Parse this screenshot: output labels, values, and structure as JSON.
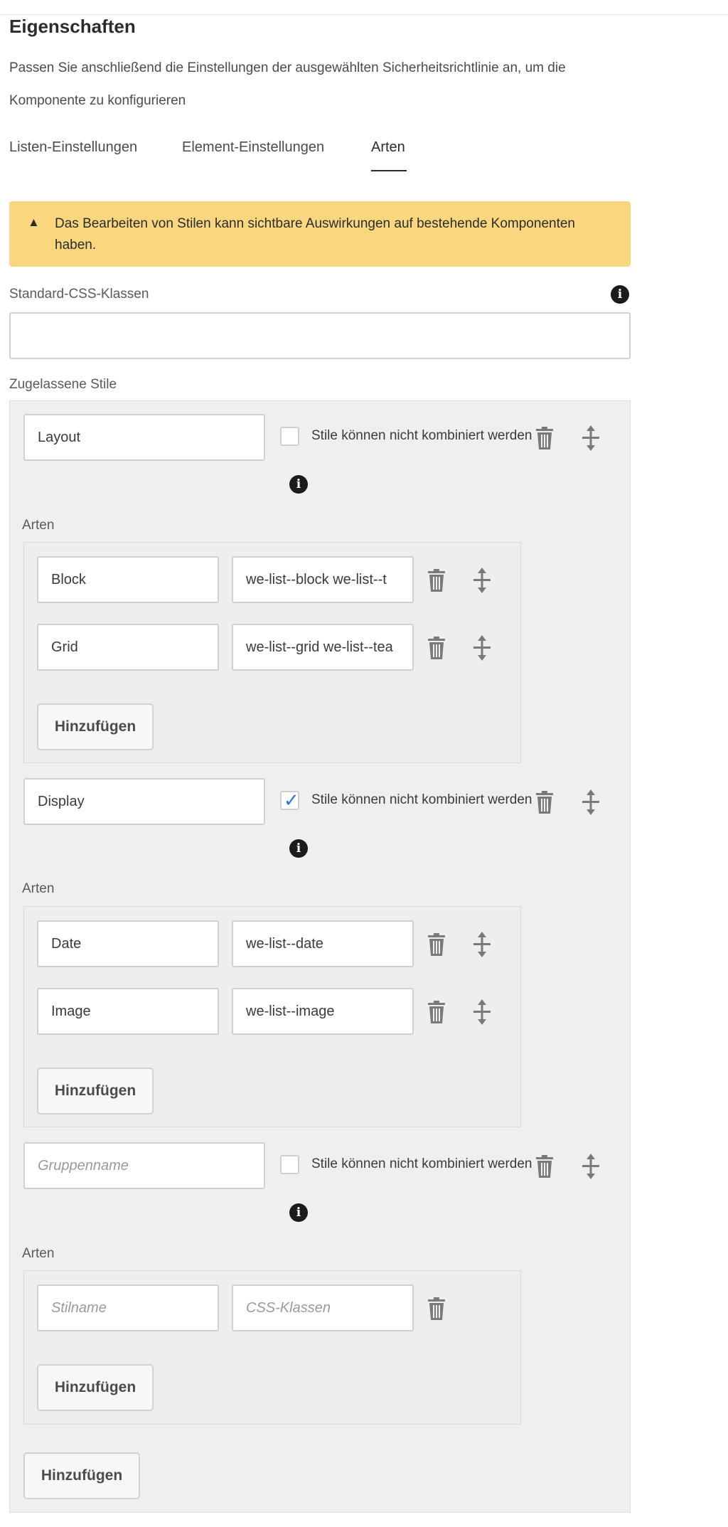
{
  "header": {
    "title": "Eigenschaften",
    "description_line1": "Passen Sie anschließend die Einstellungen der ausgewählten Sicherheitsrichtlinie an, um die",
    "description_line2": "Komponente zu konfigurieren"
  },
  "tabs": [
    {
      "label": "Listen-Einstellungen",
      "active": false
    },
    {
      "label": "Element-Einstellungen",
      "active": false
    },
    {
      "label": "Arten",
      "active": true
    }
  ],
  "alert": {
    "icon": "warning-icon",
    "text": "Das Bearbeiten von Stilen kann sichtbare Auswirkungen auf bestehende Komponenten haben."
  },
  "default_css": {
    "label": "Standard-CSS-Klassen",
    "value": ""
  },
  "allowed_styles": {
    "label": "Zugelassene Stile",
    "groups": [
      {
        "name": "Layout",
        "name_placeholder": "",
        "combine_label": "Stile können nicht kombiniert werden",
        "combine_checked": false,
        "styles_label": "Arten",
        "styles": [
          {
            "name": "Block",
            "css": "we-list--block we-list--t"
          },
          {
            "name": "Grid",
            "css": "we-list--grid we-list--tea"
          }
        ],
        "add_label": "Hinzufügen"
      },
      {
        "name": "Display",
        "name_placeholder": "",
        "combine_label": "Stile können nicht kombiniert werden",
        "combine_checked": true,
        "styles_label": "Arten",
        "styles": [
          {
            "name": "Date",
            "css": "we-list--date"
          },
          {
            "name": "Image",
            "css": "we-list--image"
          }
        ],
        "add_label": "Hinzufügen"
      },
      {
        "name": "",
        "name_placeholder": "Gruppenname",
        "combine_label": "Stile können nicht kombiniert werden",
        "combine_checked": false,
        "styles_label": "Arten",
        "styles": [
          {
            "name": "",
            "name_placeholder": "Stilname",
            "css": "",
            "css_placeholder": "CSS-Klassen"
          }
        ],
        "add_label": "Hinzufügen"
      }
    ],
    "add_group_label": "Hinzufügen"
  },
  "colors": {
    "alert_bg": "#fad67e",
    "checkbox_check": "#2d74d9",
    "panel_bg": "#efefef"
  }
}
